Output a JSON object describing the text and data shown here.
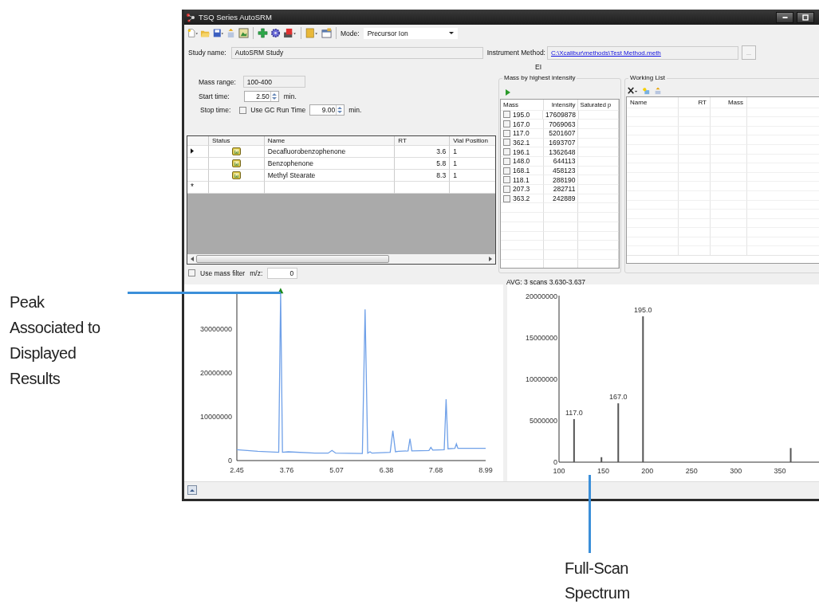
{
  "window": {
    "title": "TSQ Series AutoSRM"
  },
  "toolbar": {
    "mode_label": "Mode:",
    "mode_value": "Precursor Ion"
  },
  "study": {
    "name_label": "Study name:",
    "name_value": "AutoSRM Study",
    "method_label": "Instrument Method:",
    "method_link": "C:\\Xcalibur\\methods\\Test Method.meth",
    "browse_label": "...",
    "ionization": "EI"
  },
  "form": {
    "mass_range_label": "Mass range:",
    "mass_range_value": "100-400",
    "start_label": "Start time:",
    "start_value": "2.50",
    "start_unit": "min.",
    "stop_label": "Stop time:",
    "use_gc_label": "Use GC Run Time",
    "use_gc_checked": false,
    "stop_value": "9.00",
    "stop_unit": "min."
  },
  "compounds": {
    "columns": [
      "Status",
      "Name",
      "RT",
      "Vial Position"
    ],
    "new_row_marker": "*",
    "rows": [
      {
        "selected": true,
        "name": "Decafluorobenzophenone",
        "rt": "3.6",
        "vial": "1"
      },
      {
        "selected": false,
        "name": "Benzophenone",
        "rt": "5.8",
        "vial": "1"
      },
      {
        "selected": false,
        "name": "Methyl Stearate",
        "rt": "8.3",
        "vial": "1"
      }
    ]
  },
  "mass_filter": {
    "label": "Use mass filter",
    "checked": false,
    "mz_label": "m/z:",
    "mz_value": "0"
  },
  "mass_list": {
    "title": "Mass by highest intensity",
    "columns": [
      "Mass",
      "Intensity",
      "Saturated p"
    ],
    "rows": [
      {
        "mass": "195.0",
        "intensity": "17609878",
        "checked": false
      },
      {
        "mass": "167.0",
        "intensity": "7069063",
        "checked": false
      },
      {
        "mass": "117.0",
        "intensity": "5201607",
        "checked": false
      },
      {
        "mass": "362.1",
        "intensity": "1693707",
        "checked": false
      },
      {
        "mass": "196.1",
        "intensity": "1362648",
        "checked": false
      },
      {
        "mass": "148.0",
        "intensity": "644113",
        "checked": false
      },
      {
        "mass": "168.1",
        "intensity": "458123",
        "checked": false
      },
      {
        "mass": "118.1",
        "intensity": "288190",
        "checked": false
      },
      {
        "mass": "207.3",
        "intensity": "282711",
        "checked": false
      },
      {
        "mass": "363.2",
        "intensity": "242889",
        "checked": false
      }
    ]
  },
  "working_list": {
    "title": "Working List",
    "columns": [
      "Name",
      "RT",
      "Mass"
    ]
  },
  "scan_info": "AVG: 3 scans 3.630-3.637",
  "chromatogram": {
    "chart_data": {
      "type": "line",
      "xlim": [
        2.45,
        8.99
      ],
      "ylim": [
        0,
        38500000
      ],
      "xticks": [
        2.45,
        3.76,
        5.07,
        6.38,
        7.68,
        8.99
      ],
      "yticks": [
        0,
        10000000,
        20000000,
        30000000
      ],
      "x": [
        2.45,
        3.0,
        3.55,
        3.6,
        3.65,
        3.8,
        4.5,
        4.85,
        4.95,
        5.05,
        5.75,
        5.82,
        5.89,
        5.95,
        6.0,
        6.48,
        6.55,
        6.62,
        6.7,
        6.95,
        7.0,
        7.05,
        7.5,
        7.55,
        7.6,
        7.9,
        7.95,
        8.0,
        8.18,
        8.22,
        8.26,
        8.99
      ],
      "series": [
        {
          "color": "#6fa0e8",
          "values": [
            2500000,
            2100000,
            1900000,
            38500000,
            1900000,
            2000000,
            1700000,
            1700000,
            2300000,
            1700000,
            1600000,
            34500000,
            1700000,
            2000000,
            1700000,
            1900000,
            6800000,
            2000000,
            2100000,
            2200000,
            5000000,
            2200000,
            2300000,
            3000000,
            2400000,
            2500000,
            14000000,
            2700000,
            2800000,
            3800000,
            2800000,
            2800000
          ]
        }
      ]
    }
  },
  "spectrum": {
    "chart_data": {
      "type": "bar",
      "xlim": [
        100,
        395
      ],
      "ylim": [
        0,
        20000000
      ],
      "xticks": [
        100,
        150,
        200,
        250,
        300,
        350
      ],
      "yticks": [
        0,
        5000000,
        10000000,
        15000000,
        20000000
      ],
      "x": [
        117.0,
        148.0,
        167.0,
        195.0,
        362.1
      ],
      "series": [
        {
          "color": "#555555",
          "values": [
            5200000,
            600000,
            7100000,
            17600000,
            1700000
          ]
        }
      ],
      "annotations": [
        {
          "x": 117.0,
          "y": 5200000,
          "text": "117.0"
        },
        {
          "x": 167.0,
          "y": 7100000,
          "text": "167.0"
        },
        {
          "x": 195.0,
          "y": 17600000,
          "text": "195.0"
        }
      ]
    }
  },
  "callouts": [
    {
      "text": "Peak Associated to Displayed Results"
    },
    {
      "text": "Full-Scan Spectrum"
    }
  ]
}
